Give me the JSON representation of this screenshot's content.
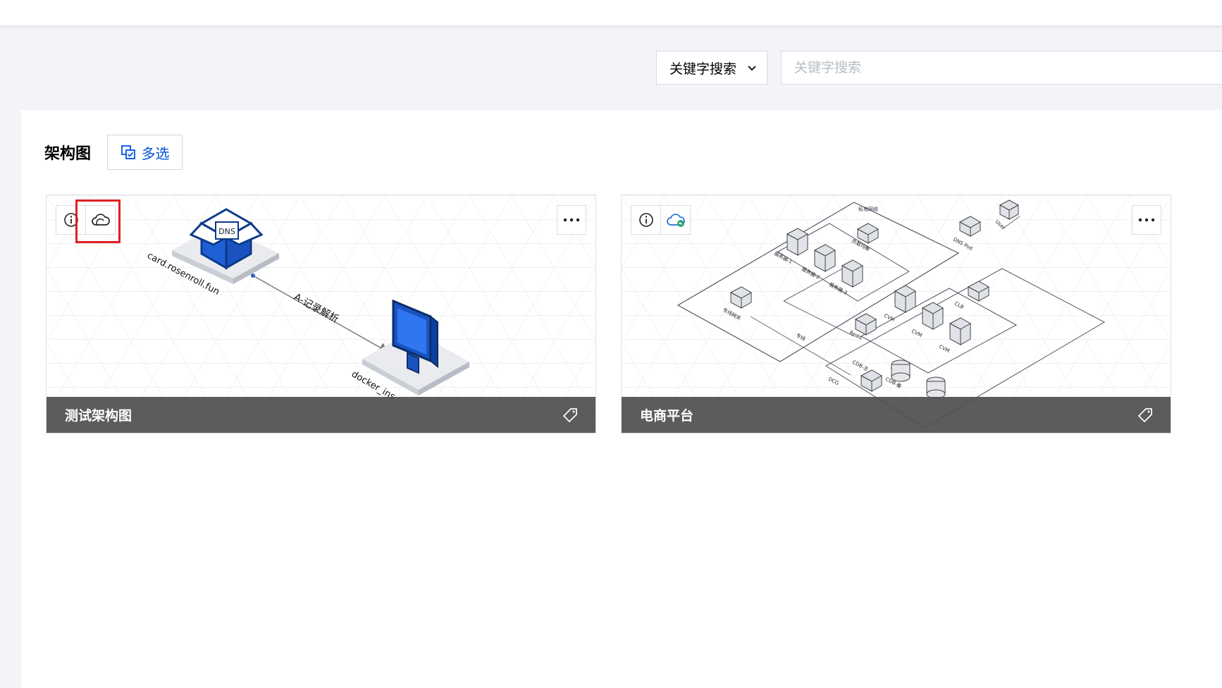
{
  "filter": {
    "selected": "关键字搜索",
    "search_placeholder": "关键字搜索"
  },
  "section": {
    "title": "架构图",
    "multi_select_label": "多选"
  },
  "cards": [
    {
      "name": "测试架构图",
      "diagram": {
        "dns_label": "DNS",
        "domain_label": "card.rosenroll.fun",
        "edge_label": "A-记录解析",
        "target_label": "docker_ins"
      }
    },
    {
      "name": "电商平台",
      "diagram": {
        "vpc_label": "私有网络",
        "servers": [
          "服务器-1",
          "服务器-2",
          "服务器-3"
        ],
        "lb_label": "负载均衡",
        "user_label": "User",
        "dns_pod_label": "DNS Pod",
        "gateway_label": "专线网关",
        "line_label": "专线",
        "clb_label": "CLB",
        "cvm_labels": [
          "CVM",
          "CVM",
          "CVM"
        ],
        "redis_label": "Redis",
        "cdb_labels": [
          "CDB-主",
          "CDB-备"
        ],
        "dcdb_label": "DCG"
      }
    }
  ],
  "colors": {
    "brand_blue": "#0052d9",
    "highlight_red": "#e02020",
    "footer_bg": "#4e4e4e"
  },
  "icons": {
    "info": "info-icon",
    "cloud": "cloud-icon",
    "more": "more-icon",
    "tag": "tag-icon",
    "chevron": "chevron-down-icon",
    "multi_select": "multi-select-icon"
  }
}
